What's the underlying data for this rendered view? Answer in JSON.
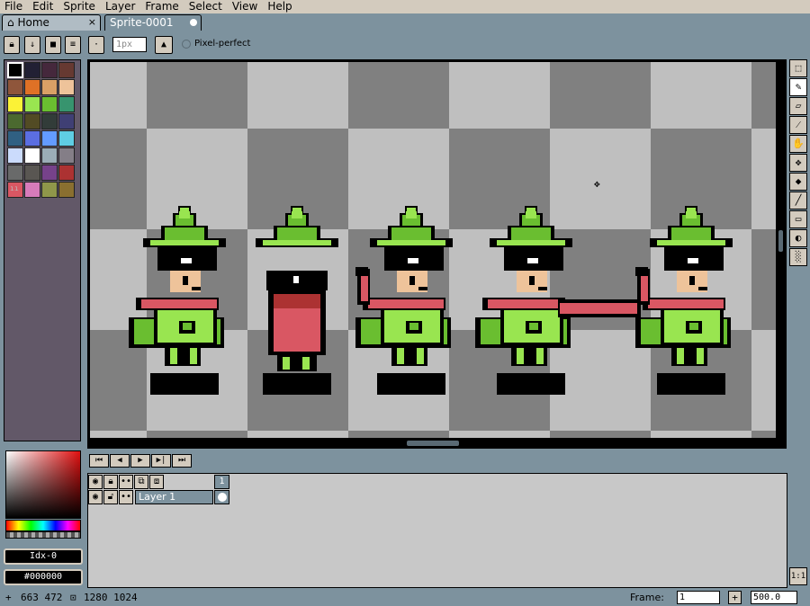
{
  "menu": [
    "File",
    "Edit",
    "Sprite",
    "Layer",
    "Frame",
    "Select",
    "View",
    "Help"
  ],
  "tabs": {
    "home": "Home",
    "home_close": "×",
    "sprite": "Sprite-0001"
  },
  "context_bar": {
    "brush_size_placeholder": "1px",
    "pixel_perfect_label": "Pixel-perfect"
  },
  "palette": {
    "colors": [
      "#000000",
      "#222034",
      "#45283c",
      "#663931",
      "#8f563b",
      "#df7126",
      "#d9a066",
      "#eec39a",
      "#fbf236",
      "#99e550",
      "#6abe30",
      "#37946e",
      "#4b692f",
      "#524b24",
      "#323c39",
      "#3f3f74",
      "#306082",
      "#5b6ee1",
      "#639bff",
      "#5fcde4",
      "#cbdbfc",
      "#ffffff",
      "#9badb7",
      "#847e87",
      "#696a6a",
      "#595652",
      "#76428a",
      "#ac3232",
      "#d95763",
      "#d77bba",
      "#8f974a",
      "#8a6f30"
    ],
    "resize_handle": "ıı"
  },
  "color_fields": {
    "index": "Idx-0",
    "hex": "#000000"
  },
  "tools": [
    {
      "name": "rectangular-marquee-icon",
      "glyph": "⬚"
    },
    {
      "name": "pencil-icon",
      "glyph": "✎"
    },
    {
      "name": "eraser-icon",
      "glyph": "▱"
    },
    {
      "name": "eyedropper-icon",
      "glyph": "⁄"
    },
    {
      "name": "hand-icon",
      "glyph": "✋"
    },
    {
      "name": "move-icon",
      "glyph": "✥"
    },
    {
      "name": "paint-bucket-icon",
      "glyph": "◆"
    },
    {
      "name": "line-icon",
      "glyph": "╱"
    },
    {
      "name": "rectangle-icon",
      "glyph": "▭"
    },
    {
      "name": "blur-icon",
      "glyph": "◐"
    },
    {
      "name": "spray-icon",
      "glyph": "░"
    }
  ],
  "playback": [
    "⏮",
    "◀",
    "▶",
    "▶|",
    "⏭"
  ],
  "timeline": {
    "layer_name": "Layer 1",
    "frame_number": "1"
  },
  "status": {
    "cursor_pos": "663 472",
    "sprite_size": "1280 1024",
    "frame_label": "Frame:",
    "frame_value": "1",
    "frame_add": "+",
    "zoom": "500.0",
    "one_to_one": "1:1"
  }
}
